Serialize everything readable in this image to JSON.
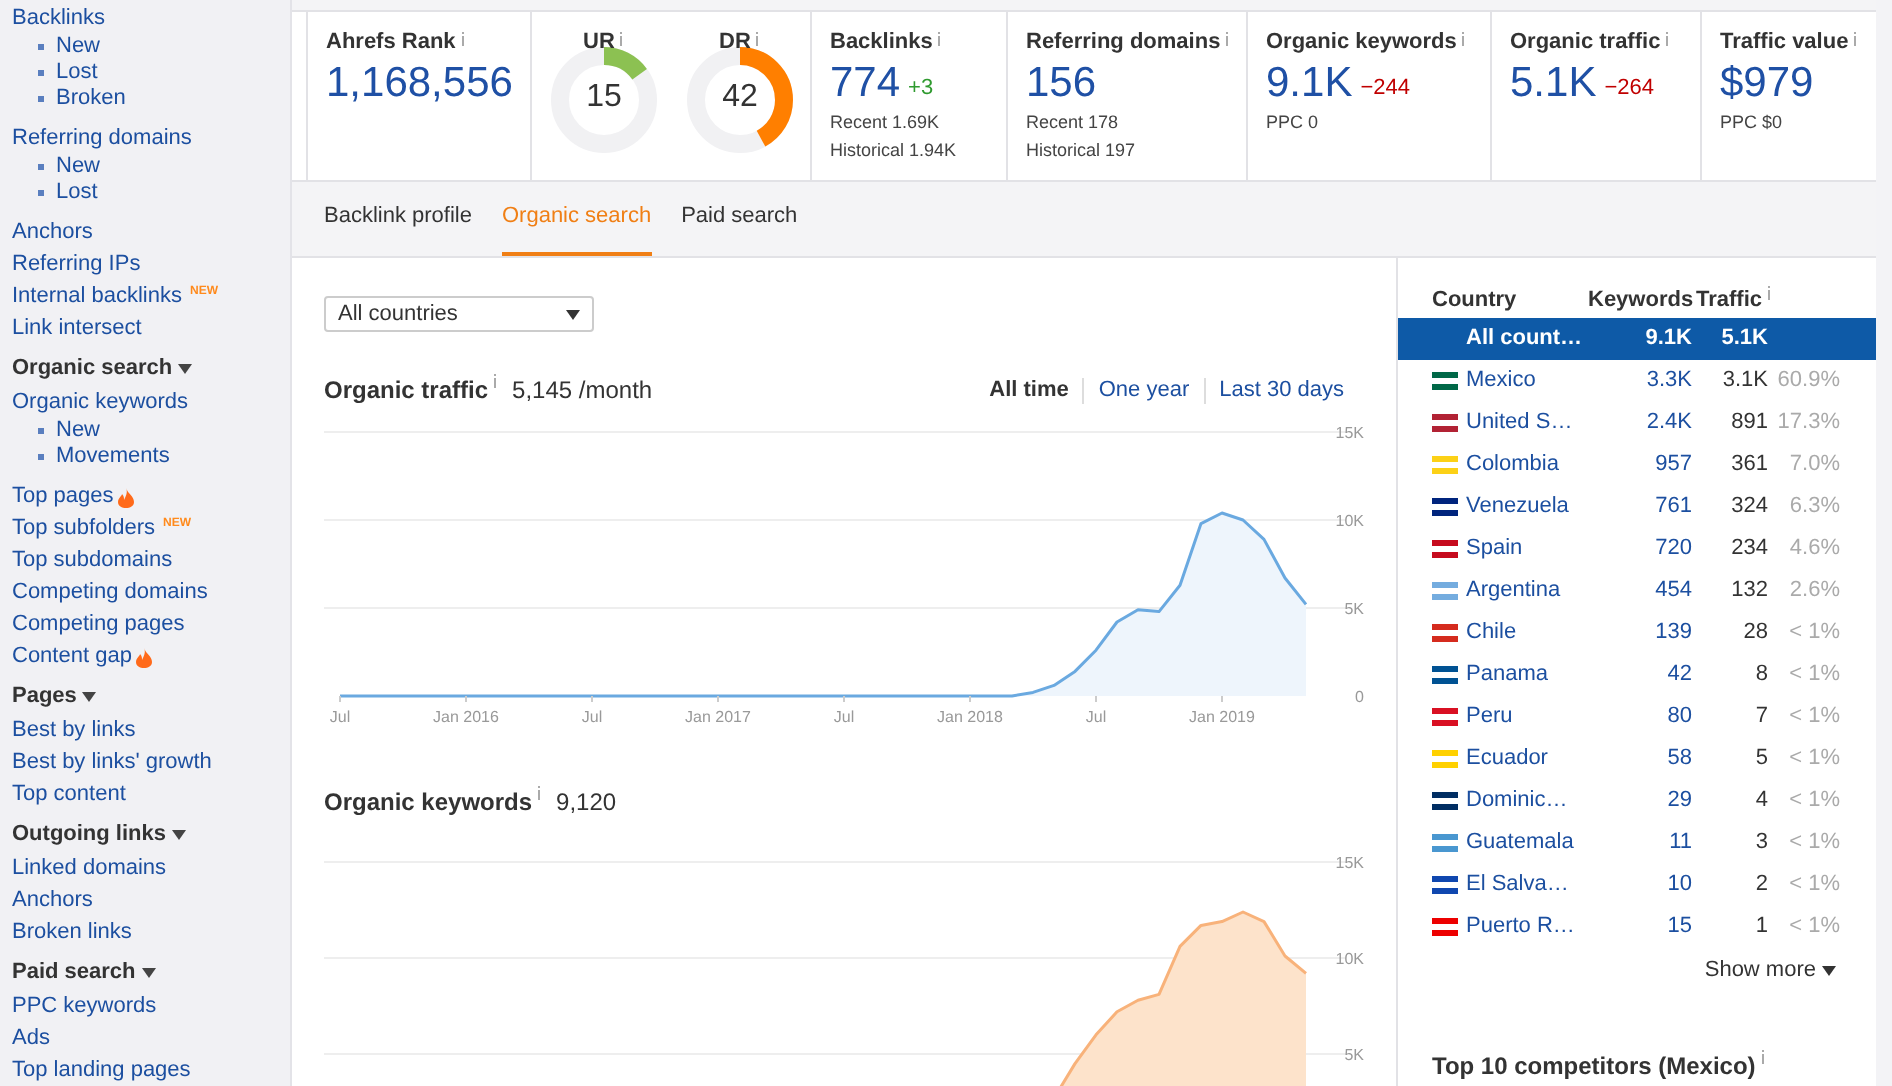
{
  "sidebar": {
    "groups": [
      {
        "items": [
          {
            "label": "Backlinks",
            "hot": false,
            "children": [
              {
                "label": "New"
              },
              {
                "label": "Lost"
              },
              {
                "label": "Broken"
              }
            ]
          },
          {
            "label": "Referring domains",
            "hot": false,
            "children": [
              {
                "label": "New"
              },
              {
                "label": "Lost"
              }
            ]
          },
          {
            "label": "Anchors",
            "hot": false
          },
          {
            "label": "Referring IPs",
            "hot": false
          },
          {
            "label": "Internal backlinks",
            "badge": "NEW",
            "hot": false
          },
          {
            "label": "Link intersect",
            "hot": false
          }
        ]
      },
      {
        "heading": "Organic search",
        "expanded": true,
        "items": [
          {
            "label": "Organic keywords",
            "hot": false,
            "children": [
              {
                "label": "New"
              },
              {
                "label": "Movements"
              }
            ]
          },
          {
            "label": "Top pages",
            "hot": true
          },
          {
            "label": "Top subfolders",
            "badge": "NEW",
            "hot": false
          },
          {
            "label": "Top subdomains",
            "hot": false
          },
          {
            "label": "Competing domains",
            "hot": false
          },
          {
            "label": "Competing pages",
            "hot": false
          },
          {
            "label": "Content gap",
            "hot": true
          }
        ]
      },
      {
        "heading": "Pages",
        "expanded": true,
        "items": [
          {
            "label": "Best by links",
            "hot": false
          },
          {
            "label": "Best by links' growth",
            "hot": false
          },
          {
            "label": "Top content",
            "hot": false
          }
        ]
      },
      {
        "heading": "Outgoing links",
        "expanded": true,
        "items": [
          {
            "label": "Linked domains",
            "hot": false
          },
          {
            "label": "Anchors",
            "hot": false
          },
          {
            "label": "Broken links",
            "hot": false
          }
        ]
      },
      {
        "heading": "Paid search",
        "expanded": true,
        "items": [
          {
            "label": "PPC keywords",
            "hot": false
          },
          {
            "label": "Ads",
            "hot": false
          },
          {
            "label": "Top landing pages",
            "hot": false
          }
        ]
      }
    ]
  },
  "stats": [
    {
      "kind": "metric",
      "label": "Ahrefs Rank",
      "value": "1,168,556"
    },
    {
      "kind": "gauges",
      "gauges": [
        {
          "label": "UR",
          "value": "15",
          "level": 0.15,
          "color": "#8cc152"
        },
        {
          "label": "DR",
          "value": "42",
          "level": 0.42,
          "color": "#ff7f00"
        }
      ]
    },
    {
      "kind": "metric",
      "label": "Backlinks",
      "value": "774",
      "delta": "+3",
      "color": "#2f9a2f",
      "details": [
        "Recent 1.69K",
        "Historical 1.94K"
      ]
    },
    {
      "kind": "metric",
      "label": "Referring domains",
      "value": "156",
      "details": [
        "Recent 178",
        "Historical 197"
      ]
    },
    {
      "kind": "metric",
      "label": "Organic keywords",
      "value": "9.1K",
      "delta": "−244",
      "color": "#c00000",
      "details": [
        "PPC 0"
      ]
    },
    {
      "kind": "metric",
      "label": "Organic traffic",
      "value": "5.1K",
      "delta": "−264",
      "color": "#c00000"
    },
    {
      "kind": "metric",
      "label": "Traffic value",
      "value": "$979",
      "details": [
        "PPC $0"
      ]
    }
  ],
  "tabs": [
    {
      "label": "Backlink profile",
      "selected": false
    },
    {
      "label": "Organic search",
      "selected": true
    },
    {
      "label": "Paid search",
      "selected": false
    }
  ],
  "filter": {
    "value": "All countries"
  },
  "traffic_chart": {
    "title": "Organic traffic",
    "summary": "5,145 /month",
    "ranges": [
      {
        "label": "All time",
        "selected": true
      },
      {
        "label": "One year",
        "selected": false
      },
      {
        "label": "Last 30 days",
        "selected": false
      }
    ],
    "chart_data": {
      "type": "area",
      "ylim": [
        0,
        15000
      ],
      "categories": [
        "Jul",
        null,
        null,
        null,
        null,
        null,
        "Jan 2016",
        null,
        null,
        null,
        null,
        null,
        "Jul",
        null,
        null,
        null,
        null,
        null,
        "Jan 2017",
        null,
        null,
        null,
        null,
        null,
        "Jul",
        null,
        null,
        null,
        null,
        null,
        "Jan 2018",
        null,
        null,
        null,
        null,
        null,
        "Jul",
        null,
        null,
        null,
        null,
        null,
        "Jan 2019",
        null,
        null,
        null,
        null
      ],
      "values": [
        0,
        0,
        0,
        0,
        0,
        0,
        0,
        0,
        0,
        0,
        0,
        0,
        0,
        0,
        0,
        0,
        0,
        0,
        0,
        0,
        0,
        0,
        0,
        0,
        0,
        0,
        0,
        0,
        0,
        0,
        0,
        0,
        0,
        200,
        600,
        1400,
        2600,
        4200,
        4900,
        4800,
        6300,
        9800,
        10400,
        10000,
        8900,
        6700,
        5200
      ],
      "yticks": [
        {
          "value": 0,
          "label": "0"
        },
        {
          "value": 5000,
          "label": "5K"
        },
        {
          "value": 10000,
          "label": "10K"
        },
        {
          "value": 15000,
          "label": "15K"
        }
      ]
    }
  },
  "keywords_chart": {
    "title": "Organic keywords",
    "summary": "9,120",
    "chart_data": {
      "type": "area",
      "ylim": [
        0,
        15000
      ],
      "values": [
        null,
        null,
        null,
        null,
        null,
        null,
        null,
        null,
        null,
        null,
        null,
        null,
        null,
        null,
        null,
        null,
        null,
        null,
        null,
        null,
        null,
        null,
        null,
        null,
        null,
        null,
        null,
        null,
        null,
        null,
        null,
        null,
        null,
        null,
        2700,
        4500,
        6000,
        7200,
        7800,
        8100,
        10600,
        11700,
        11900,
        12400,
        11900,
        10100,
        9200
      ],
      "yticks": [
        {
          "value": 5000,
          "label": "5K"
        },
        {
          "value": 10000,
          "label": "10K"
        },
        {
          "value": 15000,
          "label": "15K"
        }
      ]
    }
  },
  "countries": {
    "columns": [
      "Country",
      "Keywords",
      "Traffic"
    ],
    "rows": [
      {
        "name": "All count…",
        "keywords": "9.1K",
        "traffic": "5.1K",
        "selected": true
      },
      {
        "name": "Mexico",
        "color": "#006847",
        "keywords": "3.3K",
        "traffic": "3.1K",
        "share": "60.9%",
        "selected": false
      },
      {
        "name": "United S…",
        "color": "#b22234",
        "keywords": "2.4K",
        "traffic": "891",
        "share": "17.3%",
        "selected": false
      },
      {
        "name": "Colombia",
        "color": "#fcd116",
        "keywords": "957",
        "traffic": "361",
        "share": "7.0%",
        "selected": false
      },
      {
        "name": "Venezuela",
        "color": "#00247d",
        "keywords": "761",
        "traffic": "324",
        "share": "6.3%",
        "selected": false
      },
      {
        "name": "Spain",
        "color": "#c60b1e",
        "keywords": "720",
        "traffic": "234",
        "share": "4.6%",
        "selected": false
      },
      {
        "name": "Argentina",
        "color": "#74acdf",
        "keywords": "454",
        "traffic": "132",
        "share": "2.6%",
        "selected": false
      },
      {
        "name": "Chile",
        "color": "#d52b1e",
        "keywords": "139",
        "traffic": "28",
        "share": "< 1%",
        "selected": false
      },
      {
        "name": "Panama",
        "color": "#005293",
        "keywords": "42",
        "traffic": "8",
        "share": "< 1%",
        "selected": false
      },
      {
        "name": "Peru",
        "color": "#d91023",
        "keywords": "80",
        "traffic": "7",
        "share": "< 1%",
        "selected": false
      },
      {
        "name": "Ecuador",
        "color": "#ffd100",
        "keywords": "58",
        "traffic": "5",
        "share": "< 1%",
        "selected": false
      },
      {
        "name": "Dominic…",
        "color": "#002d62",
        "keywords": "29",
        "traffic": "4",
        "share": "< 1%",
        "selected": false
      },
      {
        "name": "Guatemala",
        "color": "#4997d0",
        "keywords": "11",
        "traffic": "3",
        "share": "< 1%",
        "selected": false
      },
      {
        "name": "El Salva…",
        "color": "#0f47af",
        "keywords": "10",
        "traffic": "2",
        "share": "< 1%",
        "selected": false
      },
      {
        "name": "Puerto R…",
        "color": "#ed0000",
        "keywords": "15",
        "traffic": "1",
        "share": "< 1%",
        "selected": false
      }
    ],
    "show_more": "Show more",
    "footer_title": "Top 10 competitors (Mexico)"
  }
}
